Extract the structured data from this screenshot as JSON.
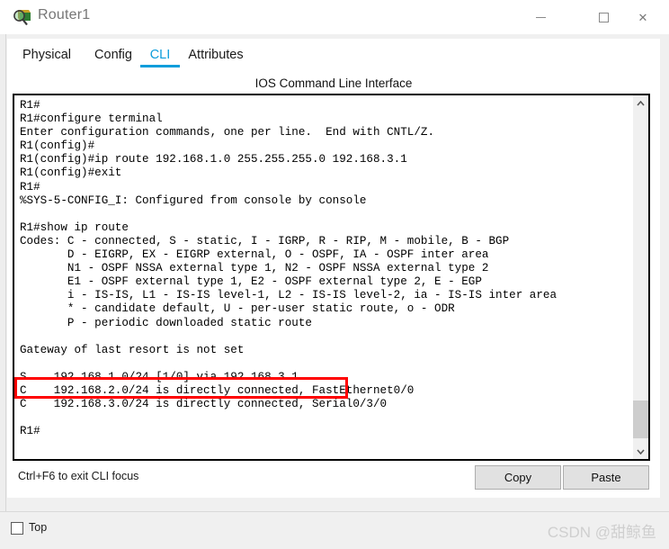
{
  "window": {
    "title": "Router1",
    "icon": "inspect-magnifier-icon",
    "controls": {
      "minimize": "minimize-icon",
      "maximize": "maximize-icon",
      "close": "✕"
    }
  },
  "tabs": [
    {
      "label": "Physical",
      "active": false
    },
    {
      "label": "Config",
      "active": false
    },
    {
      "label": "CLI",
      "active": true
    },
    {
      "label": "Attributes",
      "active": false
    }
  ],
  "cli": {
    "header": "IOS Command Line Interface",
    "terminal_text": "R1#\nR1#configure terminal\nEnter configuration commands, one per line.  End with CNTL/Z.\nR1(config)#\nR1(config)#ip route 192.168.1.0 255.255.255.0 192.168.3.1\nR1(config)#exit\nR1#\n%SYS-5-CONFIG_I: Configured from console by console\n\nR1#show ip route\nCodes: C - connected, S - static, I - IGRP, R - RIP, M - mobile, B - BGP\n       D - EIGRP, EX - EIGRP external, O - OSPF, IA - OSPF inter area\n       N1 - OSPF NSSA external type 1, N2 - OSPF NSSA external type 2\n       E1 - OSPF external type 1, E2 - OSPF external type 2, E - EGP\n       i - IS-IS, L1 - IS-IS level-1, L2 - IS-IS level-2, ia - IS-IS inter area\n       * - candidate default, U - per-user static route, o - ODR\n       P - periodic downloaded static route\n\nGateway of last resort is not set\n\nS    192.168.1.0/24 [1/0] via 192.168.3.1\nC    192.168.2.0/24 is directly connected, FastEthernet0/0\nC    192.168.3.0/24 is directly connected, Serial0/3/0\n\nR1#",
    "highlight_color": "#ff0000",
    "highlighted_line": "S    192.168.1.0/24 [1/0] via 192.168.3.1",
    "hint": "Ctrl+F6 to exit CLI focus",
    "copy_label": "Copy",
    "paste_label": "Paste",
    "scroll_up_icon": "▲",
    "scroll_down_icon": "▼"
  },
  "footer": {
    "top_checkbox_label": "Top",
    "top_checkbox_checked": false,
    "watermark": "CSDN @甜鲸鱼"
  },
  "colors": {
    "accent": "#0d9ddb",
    "highlight": "#ff0000",
    "window_bg": "#f0f0f0",
    "panel_bg": "#ffffff"
  }
}
